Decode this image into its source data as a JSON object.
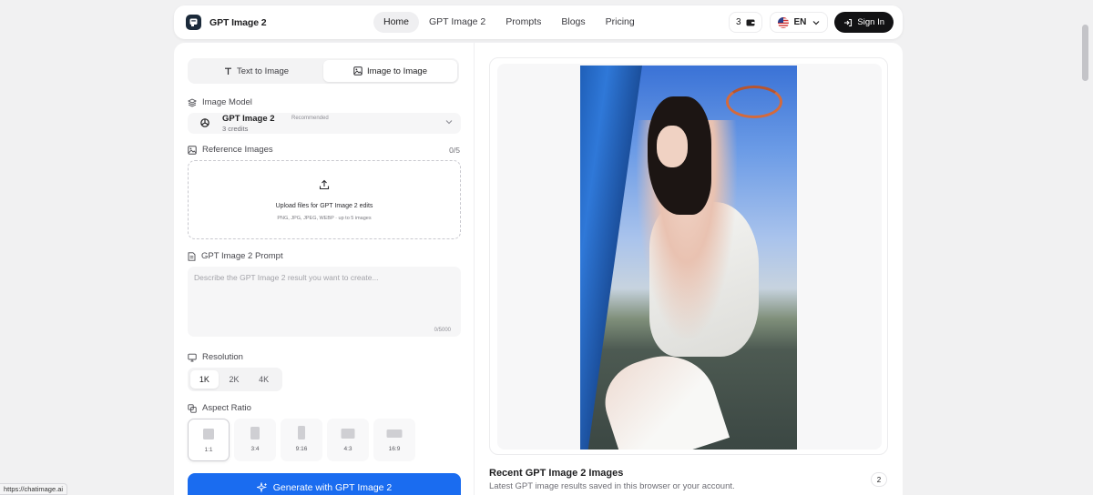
{
  "brand": {
    "name": "GPT Image 2"
  },
  "nav": {
    "items": [
      {
        "label": "Home",
        "active": true
      },
      {
        "label": "GPT Image 2",
        "active": false
      },
      {
        "label": "Prompts",
        "active": false
      },
      {
        "label": "Blogs",
        "active": false
      },
      {
        "label": "Pricing",
        "active": false
      }
    ],
    "credits": "3",
    "language": "EN",
    "sign_in": "Sign In"
  },
  "mode_tabs": [
    {
      "label": "Text to Image",
      "active": false,
      "icon": "text-icon"
    },
    {
      "label": "Image to Image",
      "active": true,
      "icon": "image-icon"
    }
  ],
  "image_model": {
    "label": "Image Model",
    "name": "GPT Image 2",
    "badge": "Recommended",
    "credits": "3 credits"
  },
  "reference_images": {
    "label": "Reference Images",
    "count": "0/5",
    "upload_title": "Upload files for GPT Image 2 edits",
    "upload_sub": "PNG, JPG, JPEG, WEBP · up to 5 images"
  },
  "prompt": {
    "label": "GPT Image 2 Prompt",
    "placeholder": "Describe the GPT Image 2 result you want to create...",
    "counter": "0/5000"
  },
  "resolution": {
    "label": "Resolution",
    "options": [
      {
        "label": "1K",
        "active": true
      },
      {
        "label": "2K",
        "active": false
      },
      {
        "label": "4K",
        "active": false
      }
    ]
  },
  "aspect_ratio": {
    "label": "Aspect Ratio",
    "options": [
      {
        "label": "1:1",
        "active": true
      },
      {
        "label": "3:4",
        "active": false
      },
      {
        "label": "9:16",
        "active": false
      },
      {
        "label": "4:3",
        "active": false
      },
      {
        "label": "16:9",
        "active": false
      }
    ]
  },
  "generate_button": "Generate with GPT Image 2",
  "recent": {
    "title": "Recent GPT Image 2 Images",
    "subtitle": "Latest GPT image results saved in this browser or your account.",
    "count": "2"
  },
  "browser": {
    "status_url": "https://chatimage.ai"
  },
  "colors": {
    "primary": "#1a6cf0",
    "dark": "#121214"
  }
}
